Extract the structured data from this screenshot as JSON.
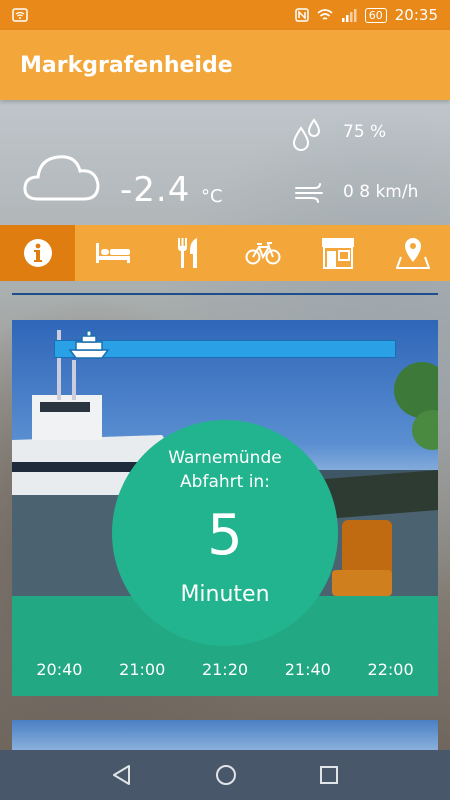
{
  "status_bar": {
    "time": "20:35",
    "battery": "60",
    "icons": [
      "wifi-notification-icon",
      "nfc-icon",
      "wifi-icon",
      "signal-icon",
      "battery-icon"
    ]
  },
  "app_bar": {
    "title": "Markgrafenheide"
  },
  "weather": {
    "condition_icon": "cloud-icon",
    "temperature": "-2.4",
    "temperature_unit": "°C",
    "humidity": "75 %",
    "wind": "0 8 km/h"
  },
  "categories": [
    {
      "name": "info",
      "icon": "info-icon",
      "active": true
    },
    {
      "name": "accommodation",
      "icon": "bed-icon",
      "active": false
    },
    {
      "name": "food",
      "icon": "cutlery-icon",
      "active": false
    },
    {
      "name": "bike",
      "icon": "bicycle-icon",
      "active": false
    },
    {
      "name": "shop",
      "icon": "shop-icon",
      "active": false
    },
    {
      "name": "map",
      "icon": "map-pin-icon",
      "active": false
    }
  ],
  "ferry_card": {
    "destination": "Warnemünde",
    "departure_label": "Abfahrt in:",
    "countdown": "5",
    "countdown_unit": "Minuten",
    "times": [
      "20:40",
      "21:00",
      "21:20",
      "21:40",
      "22:00"
    ]
  },
  "colors": {
    "status_bar": "#e8891a",
    "app_bar": "#f3a73a",
    "active_tab": "#e07d10",
    "accent_green": "#22b48e",
    "progress_blue": "#2aa0e6",
    "nav_bar": "#48586a"
  }
}
